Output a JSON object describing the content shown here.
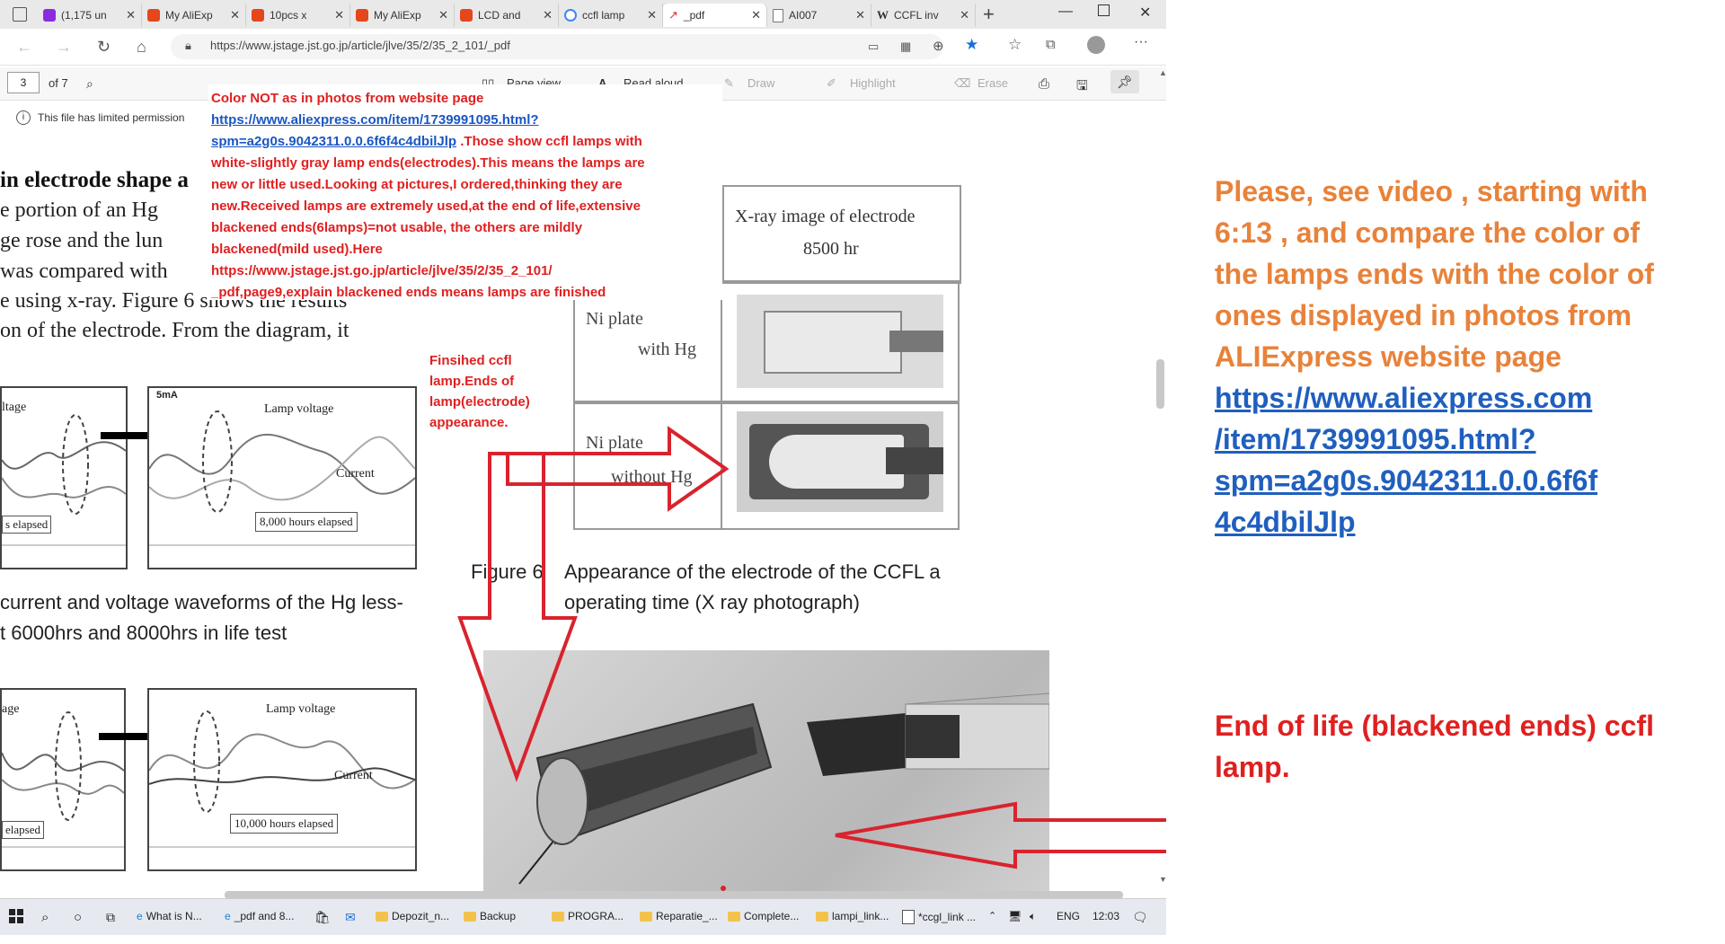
{
  "tabs": [
    {
      "label": "(1,175 un",
      "icon": "mail-icon",
      "color": "#8a2be2"
    },
    {
      "label": "My AliExp",
      "icon": "aliexpress-icon",
      "color": "#e5461b"
    },
    {
      "label": "10pcs x",
      "icon": "aliexpress-icon",
      "color": "#e5461b"
    },
    {
      "label": "My AliExp",
      "icon": "aliexpress-icon",
      "color": "#e5461b"
    },
    {
      "label": "LCD and",
      "icon": "aliexpress-icon",
      "color": "#e5461b"
    },
    {
      "label": "ccfl lamp",
      "icon": "google-icon",
      "color": "#4285f4"
    },
    {
      "label": "_pdf",
      "icon": "pdf-icon",
      "color": "#d33"
    },
    {
      "label": "AI007",
      "icon": "document-icon",
      "color": "#777"
    },
    {
      "label": "CCFL inv",
      "icon": "wikipedia-icon",
      "color": "#333"
    }
  ],
  "address": {
    "url": "https://www.jstage.jst.go.jp/article/jlve/35/2/35_2_101/_pdf"
  },
  "pdf_toolbar": {
    "page_num": "3",
    "page_total": "of 7",
    "page_view": "Page view",
    "read_aloud": "Read aloud",
    "draw": "Draw",
    "highlight": "Highlight",
    "erase": "Erase"
  },
  "info": {
    "text": "This file has limited permission"
  },
  "pdf_text": {
    "heading": "in electrode shape a",
    "lines": [
      "e portion of an Hg",
      "ge rose and the lun",
      " was compared with",
      "e using x-ray. Figure 6 shows the results",
      "on of the electrode. From the diagram, it"
    ],
    "caption5_a": "current and voltage waveforms of the Hg less-",
    "caption5_b": "t 6000hrs and 8000hrs in life test",
    "fig6_label": "Figure 6",
    "fig6_caption_a": "Appearance of the electrode of the CCFL a",
    "fig6_caption_b": "operating time (X ray photograph)",
    "panel_labels": {
      "a_left": "ltage",
      "a_elapsed": "s elapsed",
      "b_top": "5mA",
      "b_voltage": "Lamp voltage",
      "b_current": "Current",
      "b_elapsed": "8,000 hours elapsed",
      "c_left": "age",
      "c_elapsed": "elapsed",
      "d_voltage": "Lamp voltage",
      "d_current": "Current",
      "d_elapsed": "10,000 hours elapsed"
    },
    "xray_table": {
      "header_a": "X-ray image of electrode",
      "header_b": "8500 hr",
      "row1_a": "Ni plate",
      "row1_b": "with Hg",
      "row2_a": "Ni plate",
      "row2_b": "without Hg"
    }
  },
  "annotation": {
    "line1": "Color NOT as in photos from website page",
    "link1": "https://www.aliexpress.com/item/1739991095.html?",
    "link2": "spm=a2g0s.9042311.0.0.6f6f4c4dbilJlp",
    "rest1": " .Those show ccfl lamps with",
    "rest2": "white-slightly gray lamp ends(electrodes).This means the lamps are",
    "rest3": "new or little used.Looking at pictures,I ordered,thinking they are",
    "rest4": "new.Received lamps are extremely used,at the end of life,extensive",
    "rest5": "blackened ends(6lamps)=not usable, the others are mildly",
    "rest6": "blackened(mild used).Here",
    "rest7": "https://www.jstage.jst.go.jp/article/jlve/35/2/35_2_101/",
    "rest8": "_pdf,page9,explain  blackened ends means lamps are finished",
    "finished": "Finsihed ccfl lamp.Ends of lamp(electrode) appearance."
  },
  "right": {
    "orange_text": "Please, see video , starting with 6:13 , and compare the color of the lamps ends with the color of  ones displayed in photos from ALIExpress website page",
    "link": "https://www.aliexpress.com/item/1739991095.html?spm=a2g0s.9042311.0.0.6f6f4c4dbilJlp",
    "link_lines": [
      "https://www.aliexpress.com",
      "/item/1739991095.html?",
      "spm=a2g0s.9042311.0.0.6f6f",
      "4c4dbilJlp"
    ],
    "eol": "End of life (blackened ends) ccfl lamp."
  },
  "taskbar": {
    "items": [
      "What is N...",
      "_pdf and 8...",
      "Depozit_n...",
      "Backup",
      "PROGRA...",
      "Reparatie_...",
      "Complete...",
      "lampi_link...",
      "*ccgl_link ..."
    ],
    "lang": "ENG",
    "time": "12:03"
  },
  "colors": {
    "annotation_red": "#e02020",
    "orange": "#e8823a",
    "link_blue": "#1a56c4",
    "arrow_red": "#d9232d"
  }
}
